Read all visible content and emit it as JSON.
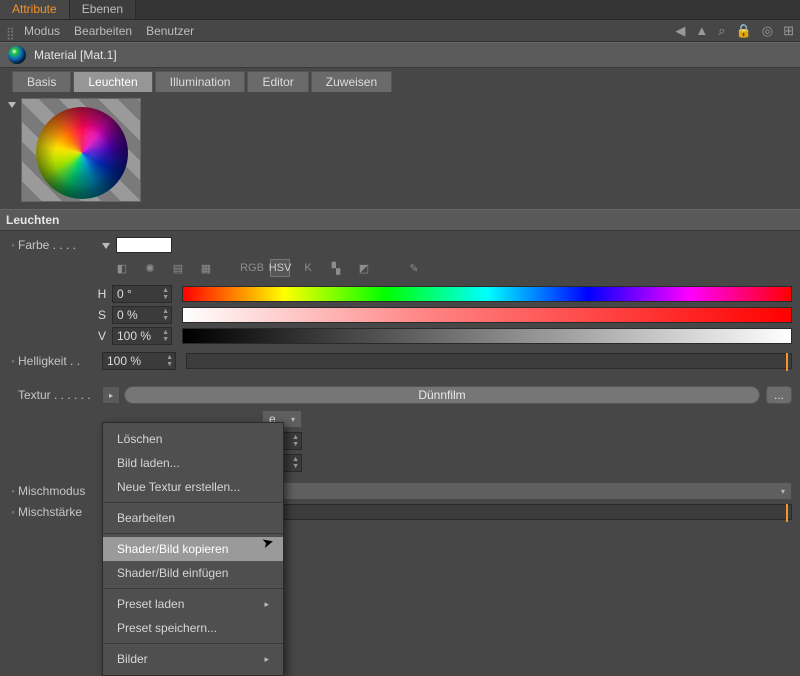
{
  "top_tabs": {
    "attribute": "Attribute",
    "ebenen": "Ebenen"
  },
  "menubar": {
    "modus": "Modus",
    "bearbeiten": "Bearbeiten",
    "benutzer": "Benutzer"
  },
  "material_title": "Material [Mat.1]",
  "channel_tabs": {
    "basis": "Basis",
    "leuchten": "Leuchten",
    "illumination": "Illumination",
    "editor": "Editor",
    "zuweisen": "Zuweisen"
  },
  "section_header": "Leuchten",
  "params": {
    "farbe_label": "Farbe . . . .",
    "helligkeit_label": "Helligkeit . .",
    "helligkeit_value": "100 %",
    "textur_label": "Textur . . . . . .",
    "textur_value": "Dünnfilm",
    "dots": "...",
    "mischmodus_label": "Mischmodus",
    "mischstaerke_label": "Mischstärke",
    "hidden_combo": "e"
  },
  "icons": {
    "row": [
      "eyedropper",
      "wheel",
      "swatches",
      "image",
      "rgb",
      "hsv",
      "k",
      "grid",
      "picker",
      "pencil"
    ],
    "rgb_text": "RGB",
    "hsv_text": "HSV",
    "k_text": "K"
  },
  "hsv": {
    "h_label": "H",
    "h_value": "0 °",
    "s_label": "S",
    "s_value": "0 %",
    "v_label": "V",
    "v_value": "100 %"
  },
  "context_menu": {
    "loeschen": "Löschen",
    "bild_laden": "Bild laden...",
    "neue_textur": "Neue Textur erstellen...",
    "bearbeiten": "Bearbeiten",
    "shader_kopieren": "Shader/Bild kopieren",
    "shader_einfuegen": "Shader/Bild einfügen",
    "preset_laden": "Preset laden",
    "preset_speichern": "Preset speichern...",
    "bilder": "Bilder"
  },
  "colors": {
    "accent": "#f79227",
    "swatch": "#ffffff"
  }
}
